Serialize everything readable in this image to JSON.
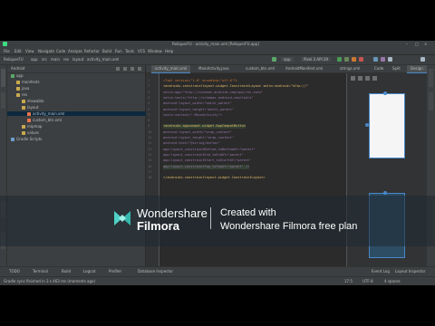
{
  "window": {
    "title": "ReliquerFU - activity_main.xml [ReliquerFU.app]",
    "controls": [
      "–",
      "□",
      "×"
    ]
  },
  "menu": [
    "File",
    "Edit",
    "View",
    "Navigate",
    "Code",
    "Analyze",
    "Refactor",
    "Build",
    "Run",
    "Tools",
    "VCS",
    "Window",
    "Help"
  ],
  "breadcrumbs": [
    "ReliquerFU",
    "app",
    "src",
    "main",
    "res",
    "layout",
    "activity_main.xml"
  ],
  "toolbar": {
    "run_config": "app",
    "device": "Pixel 3 API 29"
  },
  "project_panel": {
    "title": "Android",
    "tree": [
      {
        "label": "app",
        "depth": 0,
        "kind": "module"
      },
      {
        "label": "manifests",
        "depth": 1,
        "kind": "folder"
      },
      {
        "label": "java",
        "depth": 1,
        "kind": "folder"
      },
      {
        "label": "res",
        "depth": 1,
        "kind": "folder"
      },
      {
        "label": "drawable",
        "depth": 2,
        "kind": "folder"
      },
      {
        "label": "layout",
        "depth": 2,
        "kind": "folder"
      },
      {
        "label": "activity_main.xml",
        "depth": 3,
        "kind": "file",
        "selected": true
      },
      {
        "label": "custom_btn.xml",
        "depth": 3,
        "kind": "file"
      },
      {
        "label": "mipmap",
        "depth": 2,
        "kind": "folder"
      },
      {
        "label": "values",
        "depth": 2,
        "kind": "folder"
      },
      {
        "label": "Gradle Scripts",
        "depth": 0,
        "kind": "gradle"
      }
    ]
  },
  "editor_tabs": [
    {
      "label": "activity_main.xml",
      "active": true
    },
    {
      "label": "MainActivity.java",
      "active": false
    },
    {
      "label": "custom_btn.xml",
      "active": false
    },
    {
      "label": "AndroidManifest.xml",
      "active": false
    },
    {
      "label": "strings.xml",
      "active": false
    }
  ],
  "editor_view_modes": [
    "Code",
    "Split",
    "Design"
  ],
  "code_lines": [
    {
      "n": "1",
      "text": "<?xml version=\"1.0\" encoding=\"utf-8\"?>",
      "hl": ""
    },
    {
      "n": "2",
      "text": "<androidx.constraintlayout.widget.ConstraintLayout xmlns:android=\"http://\"",
      "hl": ""
    },
    {
      "n": "3",
      "text": "    xmlns:app=\"http://schemas.android.com/apk/res-auto\"",
      "hl": ""
    },
    {
      "n": "4",
      "text": "    xmlns:tools=\"http://schemas.android.com/tools\"",
      "hl": ""
    },
    {
      "n": "5",
      "text": "    android:layout_width=\"match_parent\"",
      "hl": ""
    },
    {
      "n": "6",
      "text": "    android:layout_height=\"match_parent\"",
      "hl": ""
    },
    {
      "n": "7",
      "text": "    tools:context=\".MainActivity\">",
      "hl": ""
    },
    {
      "n": "8",
      "text": "",
      "hl": ""
    },
    {
      "n": "9",
      "text": "    <androidx.appcompat.widget.AppCompatButton",
      "hl": "green"
    },
    {
      "n": "10",
      "text": "        android:layout_width=\"wrap_content\"",
      "hl": ""
    },
    {
      "n": "11",
      "text": "        android:layout_height=\"wrap_content\"",
      "hl": ""
    },
    {
      "n": "12",
      "text": "        android:text=\"@string/button\"",
      "hl": ""
    },
    {
      "n": "13",
      "text": "        app:layout_constraintBottom_toBottomOf=\"parent\"",
      "hl": ""
    },
    {
      "n": "14",
      "text": "        app:layout_constraintEnd_toEndOf=\"parent\"",
      "hl": ""
    },
    {
      "n": "15",
      "text": "        app:layout_constraintStart_toStartOf=\"parent\"",
      "hl": ""
    },
    {
      "n": "16",
      "text": "        app:layout_constraintTop_toTopOf=\"parent\" />",
      "hl": "green"
    },
    {
      "n": "17",
      "text": "",
      "hl": "blue"
    },
    {
      "n": "18",
      "text": "</androidx.constraintlayout.widget.ConstraintLayout>",
      "hl": ""
    }
  ],
  "bottom_tools": [
    "TODO",
    "Terminal",
    "Build",
    "Logcat",
    "Profiler",
    "Database Inspector",
    "Event Log",
    "Layout Inspector"
  ],
  "status": {
    "message": "Gradle sync finished in 3 s 463 ms (moments ago)",
    "position": "17:5",
    "encoding": "UTF-8",
    "spaces": "4 spaces"
  },
  "watermark": {
    "brand_line1": "Wondershare",
    "brand_line2": "Filmora",
    "caption_line1": "Created with",
    "caption_line2": "Wondershare Filmora free plan"
  },
  "colors": {
    "ide_bg": "#2b2b2b",
    "panel_bg": "#3c3f41",
    "accent": "#4a88c7",
    "code_highlight": "#344134",
    "filmora_accent": "#4fd1c5"
  }
}
